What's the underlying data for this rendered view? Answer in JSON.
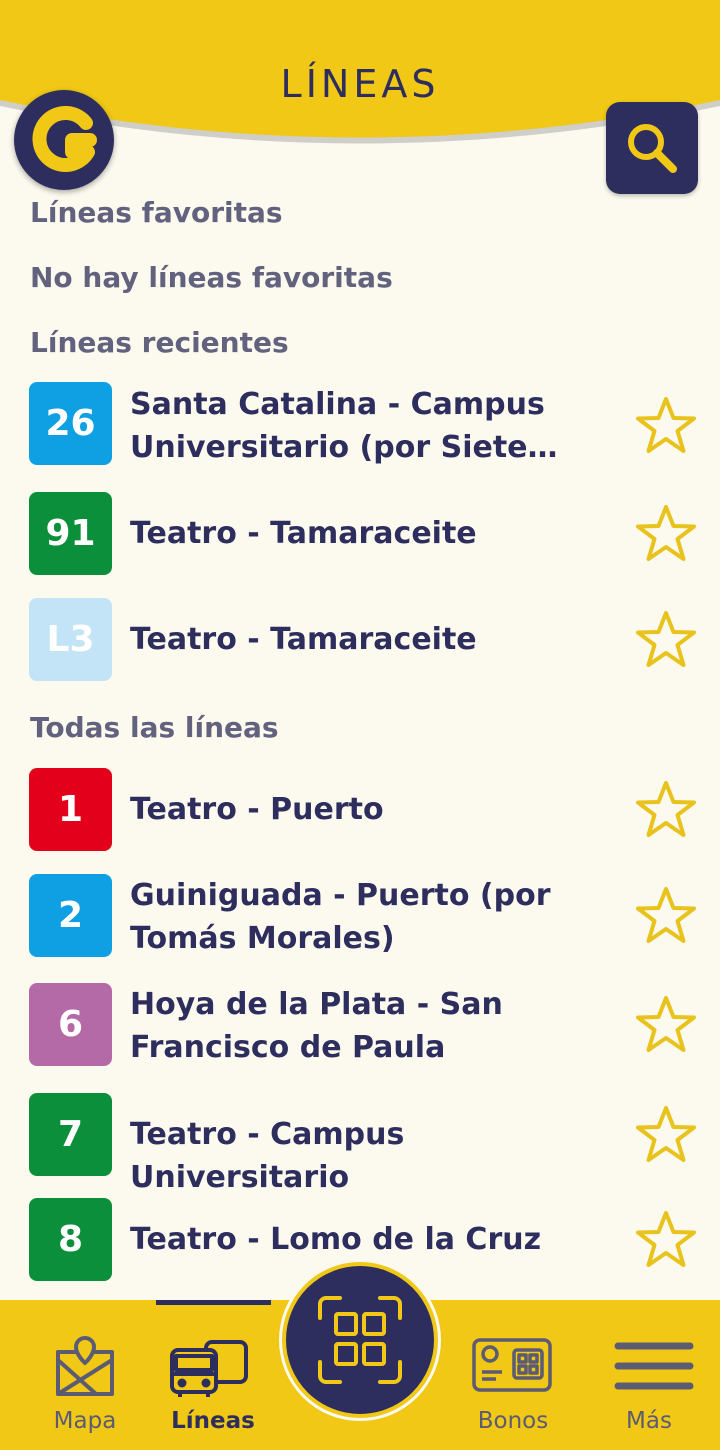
{
  "header": {
    "title": "LÍNEAS"
  },
  "sections": {
    "favorites_title": "Líneas favoritas",
    "favorites_empty": "No hay líneas favoritas",
    "recent_title": "Líneas recientes",
    "all_title": "Todas las líneas"
  },
  "recent_lines": [
    {
      "number": "26",
      "name": "Santa Catalina - Campus Universitario (por Siete Palmas)",
      "color": "#0ea0e2"
    },
    {
      "number": "91",
      "name": "Teatro - Tamaraceite",
      "color": "#0b8f3a"
    },
    {
      "number": "L3",
      "name": "Teatro - Tamaraceite",
      "color": "#c3e3f6"
    }
  ],
  "all_lines": [
    {
      "number": "1",
      "name": "Teatro - Puerto",
      "color": "#e2001a"
    },
    {
      "number": "2",
      "name": "Guiniguada - Puerto (por Tomás Morales)",
      "color": "#0ea0e2"
    },
    {
      "number": "6",
      "name": "Hoya de la Plata - San Francisco de Paula",
      "color": "#b56aa8"
    },
    {
      "number": "7",
      "name": "Teatro - Campus Universitario",
      "color": "#0b8f3a"
    },
    {
      "number": "8",
      "name": "Teatro - Lomo de la Cruz",
      "color": "#0b8f3a"
    }
  ],
  "nav": {
    "map": "Mapa",
    "lines": "Líneas",
    "bonos": "Bonos",
    "more": "Más"
  },
  "colors": {
    "brand_yellow": "#f0c815",
    "brand_navy": "#2e2e5e",
    "star": "#e8c21d"
  }
}
